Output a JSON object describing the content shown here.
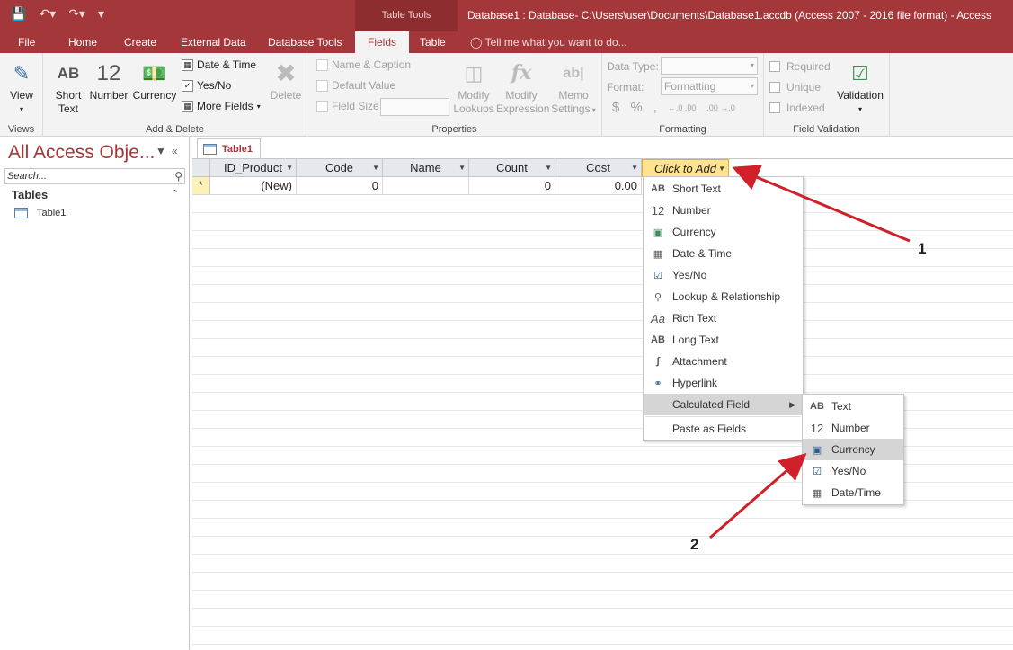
{
  "quick_access": {
    "save_icon": "save-icon",
    "undo_icon": "undo-icon",
    "redo_icon": "redo-icon",
    "customize_icon": "customize-qat-icon"
  },
  "contextual_group": "Table Tools",
  "window_title": "Database1 : Database- C:\\Users\\user\\Documents\\Database1.accdb (Access 2007 - 2016 file format) - Access",
  "tabs": {
    "file": "File",
    "home": "Home",
    "create": "Create",
    "external": "External Data",
    "dbtools": "Database Tools",
    "fields": "Fields",
    "table": "Table"
  },
  "tell_me": "Tell me what you want to do...",
  "ribbon": {
    "views": {
      "view": "View",
      "label": "Views"
    },
    "add_delete": {
      "short_text_top": "Short",
      "short_text_bottom": "Text",
      "short_text_glyph": "AB",
      "number": "Number",
      "number_glyph": "12",
      "currency": "Currency",
      "date_time": "Date & Time",
      "yes_no": "Yes/No",
      "more_fields": "More Fields",
      "delete": "Delete",
      "label": "Add & Delete"
    },
    "properties": {
      "name_caption": "Name & Caption",
      "default_value": "Default Value",
      "field_size": "Field Size",
      "modify_lookups_top": "Modify",
      "modify_lookups_bottom": "Lookups",
      "modify_expr_top": "Modify",
      "modify_expr_bottom": "Expression",
      "memo_top": "Memo",
      "memo_bottom": "Settings",
      "label": "Properties"
    },
    "formatting": {
      "data_type": "Data Type:",
      "format": "Format:",
      "format_value": "Formatting",
      "currency_sym": "$",
      "percent_sym": "%",
      "comma_sym": ",",
      "inc_dec": "←.0 .00",
      "dec_dec": ".00 →.0",
      "label": "Formatting"
    },
    "validation": {
      "required": "Required",
      "unique": "Unique",
      "indexed": "Indexed",
      "validation": "Validation",
      "label": "Field Validation"
    }
  },
  "nav": {
    "title": "All Access Obje...",
    "search_placeholder": "Search...",
    "section": "Tables",
    "items": [
      "Table1"
    ]
  },
  "document": {
    "tab": "Table1"
  },
  "grid": {
    "headers": [
      "ID_Product",
      "Code",
      "Name",
      "Count",
      "Cost",
      "Click to Add"
    ],
    "new_row": [
      "(New)",
      "0",
      "",
      "0",
      "0.00",
      ""
    ],
    "new_row_marker": "*"
  },
  "menu_add": [
    {
      "icon": "AB",
      "label": "Short Text"
    },
    {
      "icon": "12",
      "label": "Number"
    },
    {
      "icon": "currency-icon",
      "label": "Currency"
    },
    {
      "icon": "date-time-icon",
      "label": "Date & Time"
    },
    {
      "icon": "checkbox-icon",
      "label": "Yes/No"
    },
    {
      "icon": "lookup-icon",
      "label": "Lookup & Relationship"
    },
    {
      "icon": "Aa",
      "label": "Rich Text"
    },
    {
      "icon": "AB",
      "label": "Long Text"
    },
    {
      "icon": "paperclip-icon",
      "label": "Attachment"
    },
    {
      "icon": "hyperlink-icon",
      "label": "Hyperlink"
    },
    {
      "icon": "",
      "label": "Calculated Field"
    },
    {
      "icon": "",
      "label": "Paste as Fields"
    }
  ],
  "menu_calculated": [
    {
      "icon": "AB",
      "label": "Text"
    },
    {
      "icon": "12",
      "label": "Number"
    },
    {
      "icon": "currency-icon",
      "label": "Currency"
    },
    {
      "icon": "checkbox-icon",
      "label": "Yes/No"
    },
    {
      "icon": "date-time-icon",
      "label": "Date/Time"
    }
  ],
  "annotations": {
    "first": "1",
    "second": "2",
    "color": "#d0202a"
  },
  "colors": {
    "accent": "#a4373a",
    "highlight": "#ffe38f"
  }
}
